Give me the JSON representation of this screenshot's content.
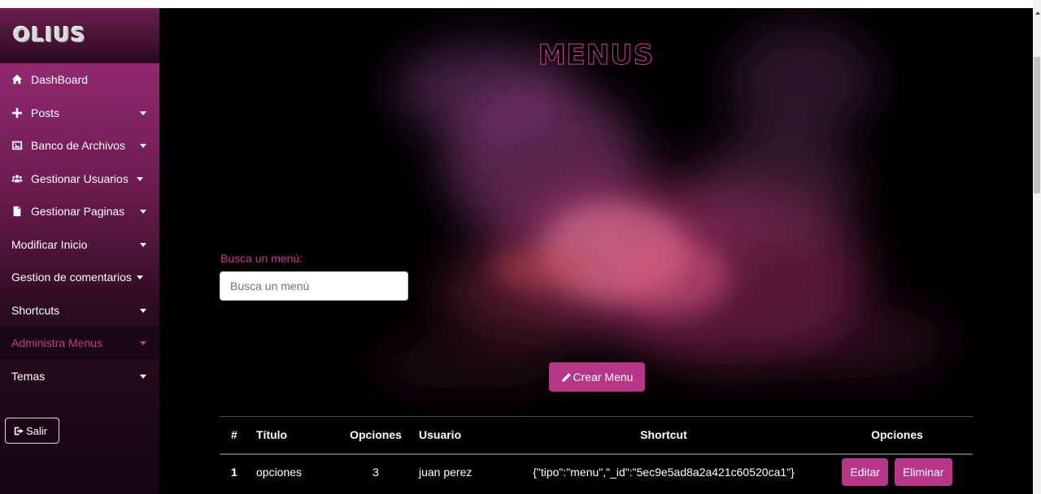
{
  "sidebar": {
    "logo": "OLIUS",
    "items": [
      {
        "label": "DashBoard",
        "icon": "home-icon"
      },
      {
        "label": "Posts",
        "icon": "plus-icon"
      },
      {
        "label": "Banco de Archivos",
        "icon": "image-icon"
      },
      {
        "label": "Gestionar Usuarios",
        "icon": "users-icon"
      },
      {
        "label": "Gestionar Paginas",
        "icon": "file-icon"
      },
      {
        "label": "Modificar Inicio"
      },
      {
        "label": "Gestion de comentarios"
      },
      {
        "label": "Shortcuts"
      },
      {
        "label": "Administra Menus",
        "active": true
      },
      {
        "label": "Temas"
      }
    ],
    "logout_label": "Salir"
  },
  "main": {
    "title": "MENUS",
    "search": {
      "label": "Busca un menú:",
      "placeholder": "Busca un menú"
    },
    "create_button": "Crear Menu"
  },
  "table": {
    "columns": [
      "#",
      "Título",
      "Opciones",
      "Usuario",
      "Shortcut",
      "Opciones"
    ],
    "rows": [
      {
        "num": "1",
        "titulo": "opciones",
        "opciones": "3",
        "usuario": "juan perez",
        "shortcut": "{\"tipo\":\"menu\",\"_id\":\"5ec9e5ad8a2a421c60520ca1\"}",
        "edit_label": "Editar",
        "delete_label": "Eliminar"
      }
    ]
  },
  "colors": {
    "accent": "#b93588",
    "accent_text": "#c33a93",
    "background": "#000000"
  }
}
